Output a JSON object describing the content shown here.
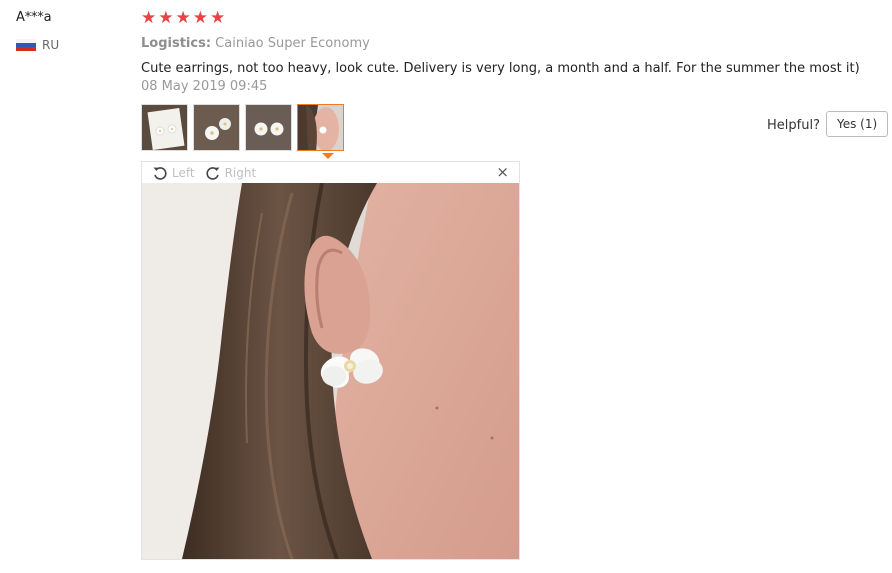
{
  "reviewer": {
    "name": "A***a",
    "country": "RU"
  },
  "rating": {
    "stars": 5,
    "max": 5,
    "star_glyph": "★"
  },
  "logistics": {
    "label": "Logistics:",
    "value": "Cainiao Super Economy"
  },
  "review": {
    "text": "Cute earrings, not too heavy, look cute. Delivery is very long, a month and a half. For the summer the most it)",
    "date": "08 May 2019 09:45"
  },
  "thumbnails": [
    {
      "name": "photo-thumb-1",
      "active": false
    },
    {
      "name": "photo-thumb-2",
      "active": false
    },
    {
      "name": "photo-thumb-3",
      "active": false
    },
    {
      "name": "photo-thumb-4",
      "active": true
    }
  ],
  "helpful": {
    "label": "Helpful?",
    "yes_label": "Yes (1)"
  },
  "viewer": {
    "rotate_left": "Left",
    "rotate_right": "Right",
    "close": "×"
  },
  "colors": {
    "star": "#e84347",
    "accent": "#f07c22",
    "muted": "#999999"
  }
}
